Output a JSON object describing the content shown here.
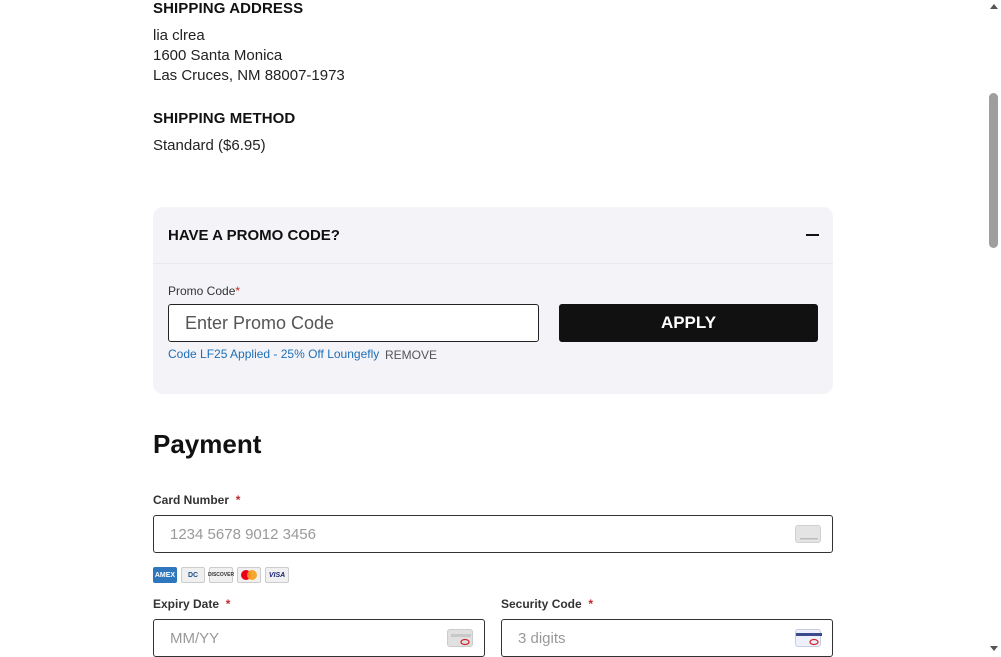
{
  "shipping_address": {
    "title": "SHIPPING ADDRESS",
    "name": "lia clrea",
    "street": "1600 Santa Monica",
    "city_line": "Las Cruces, NM 88007-1973"
  },
  "shipping_method": {
    "title": "SHIPPING METHOD",
    "value": "Standard ($6.95)"
  },
  "promo": {
    "header": "HAVE A PROMO CODE?",
    "label": "Promo Code",
    "required_mark": "*",
    "placeholder": "Enter Promo Code",
    "apply_label": "APPLY",
    "applied_text": "Code LF25 Applied - 25% Off Loungefly",
    "remove_label": "REMOVE"
  },
  "payment": {
    "title": "Payment",
    "card_number_label": "Card Number",
    "card_number_placeholder": "1234 5678 9012 3456",
    "expiry_label": "Expiry Date",
    "expiry_placeholder": "MM/YY",
    "security_label": "Security Code",
    "security_placeholder": "3 digits",
    "required_mark": "*",
    "accepted_cards": [
      "amex-icon",
      "diners-club-icon",
      "discover-icon",
      "mastercard-icon",
      "visa-icon"
    ],
    "accepted_card_labels": {
      "amex": "AMEX",
      "diners": "DC",
      "discover": "DISCOVER",
      "visa": "VISA"
    }
  },
  "colors": {
    "promo_bg": "#f4f3f8",
    "button_bg": "#111111",
    "applied_text": "#1f6fb5",
    "required": "#c0282d"
  }
}
